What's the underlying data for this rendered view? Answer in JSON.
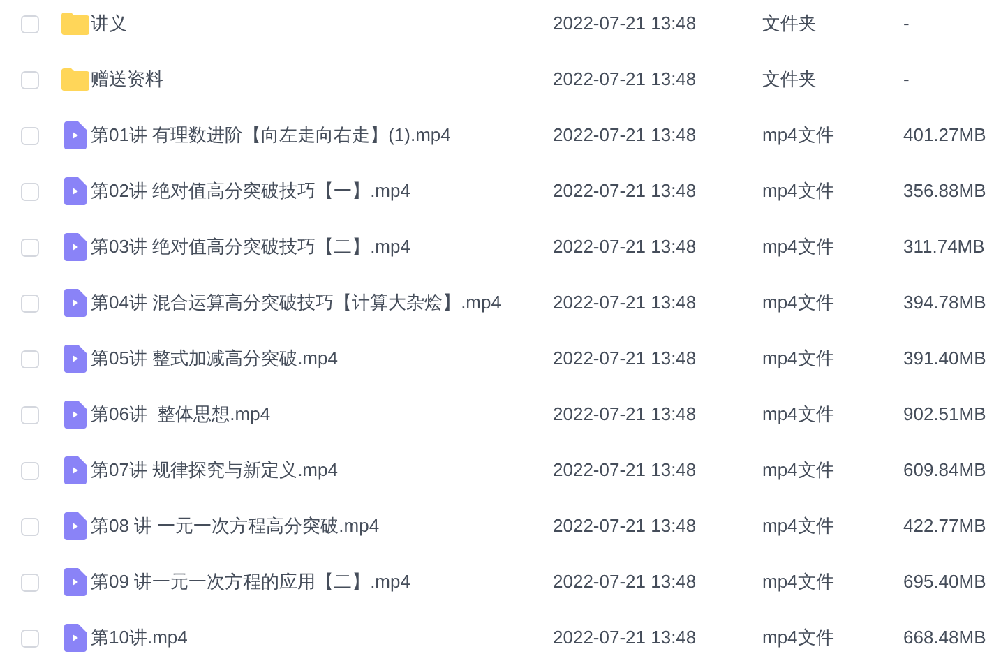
{
  "files": [
    {
      "kind": "folder",
      "checked": false,
      "name": "讲义",
      "modified": "2022-07-21 13:48",
      "type": "文件夹",
      "size": "-"
    },
    {
      "kind": "folder",
      "checked": false,
      "name": "赠送资料",
      "modified": "2022-07-21 13:48",
      "type": "文件夹",
      "size": "-"
    },
    {
      "kind": "video",
      "checked": false,
      "name": "第01讲 有理数进阶【向左走向右走】(1).mp4",
      "modified": "2022-07-21 13:48",
      "type": "mp4文件",
      "size": "401.27MB"
    },
    {
      "kind": "video",
      "checked": false,
      "name": "第02讲 绝对值高分突破技巧【一】.mp4",
      "modified": "2022-07-21 13:48",
      "type": "mp4文件",
      "size": "356.88MB"
    },
    {
      "kind": "video",
      "checked": false,
      "name": "第03讲 绝对值高分突破技巧【二】.mp4",
      "modified": "2022-07-21 13:48",
      "type": "mp4文件",
      "size": "311.74MB"
    },
    {
      "kind": "video",
      "checked": false,
      "name": "第04讲 混合运算高分突破技巧【计算大杂烩】.mp4",
      "modified": "2022-07-21 13:48",
      "type": "mp4文件",
      "size": "394.78MB"
    },
    {
      "kind": "video",
      "checked": false,
      "name": "第05讲 整式加减高分突破.mp4",
      "modified": "2022-07-21 13:48",
      "type": "mp4文件",
      "size": "391.40MB"
    },
    {
      "kind": "video",
      "checked": false,
      "name": "第06讲  整体思想.mp4",
      "modified": "2022-07-21 13:48",
      "type": "mp4文件",
      "size": "902.51MB"
    },
    {
      "kind": "video",
      "checked": false,
      "name": "第07讲 规律探究与新定义.mp4",
      "modified": "2022-07-21 13:48",
      "type": "mp4文件",
      "size": "609.84MB"
    },
    {
      "kind": "video",
      "checked": false,
      "name": "第08 讲 一元一次方程高分突破.mp4",
      "modified": "2022-07-21 13:48",
      "type": "mp4文件",
      "size": "422.77MB"
    },
    {
      "kind": "video",
      "checked": false,
      "name": "第09 讲一元一次方程的应用【二】.mp4",
      "modified": "2022-07-21 13:48",
      "type": "mp4文件",
      "size": "695.40MB"
    },
    {
      "kind": "video",
      "checked": false,
      "name": "第10讲.mp4",
      "modified": "2022-07-21 13:48",
      "type": "mp4文件",
      "size": "668.48MB"
    }
  ]
}
